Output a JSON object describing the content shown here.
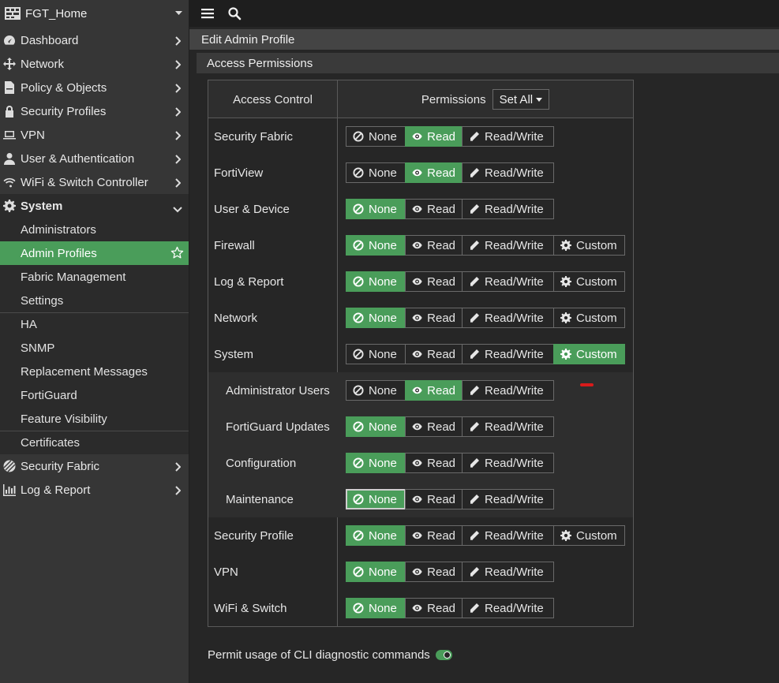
{
  "device": {
    "name": "FGT_Home"
  },
  "nav": {
    "dashboard": "Dashboard",
    "network": "Network",
    "policy": "Policy & Objects",
    "security_profiles": "Security Profiles",
    "vpn": "VPN",
    "user_auth": "User & Authentication",
    "wifi": "WiFi & Switch Controller",
    "system": "System",
    "system_items": {
      "administrators": "Administrators",
      "admin_profiles": "Admin Profiles",
      "fabric_management": "Fabric Management",
      "settings": "Settings",
      "ha": "HA",
      "snmp": "SNMP",
      "replacement_messages": "Replacement Messages",
      "fortiguard": "FortiGuard",
      "feature_visibility": "Feature Visibility",
      "certificates": "Certificates"
    },
    "security_fabric": "Security Fabric",
    "log_report": "Log & Report"
  },
  "page": {
    "title": "Edit Admin Profile",
    "section": "Access Permissions"
  },
  "table": {
    "col_access": "Access Control",
    "col_permissions": "Permissions",
    "set_all": "Set All",
    "opt_none": "None",
    "opt_read": "Read",
    "opt_rw": "Read/Write",
    "opt_custom": "Custom",
    "rows": [
      {
        "label": "Security Fabric",
        "selected": "Read",
        "custom": false
      },
      {
        "label": "FortiView",
        "selected": "Read",
        "custom": false
      },
      {
        "label": "User & Device",
        "selected": "None",
        "custom": false
      },
      {
        "label": "Firewall",
        "selected": "None",
        "custom": true
      },
      {
        "label": "Log & Report",
        "selected": "None",
        "custom": true
      },
      {
        "label": "Network",
        "selected": "None",
        "custom": true
      },
      {
        "label": "System",
        "selected": "Custom",
        "custom": true
      },
      {
        "label": "Administrator Users",
        "selected": "Read",
        "custom": false
      },
      {
        "label": "FortiGuard Updates",
        "selected": "None",
        "custom": false
      },
      {
        "label": "Configuration",
        "selected": "None",
        "custom": false
      },
      {
        "label": "Maintenance",
        "selected": "None",
        "custom": false
      },
      {
        "label": "Security Profile",
        "selected": "None",
        "custom": true
      },
      {
        "label": "VPN",
        "selected": "None",
        "custom": false
      },
      {
        "label": "WiFi & Switch",
        "selected": "None",
        "custom": false
      }
    ]
  },
  "cli": {
    "label": "Permit usage of CLI diagnostic commands",
    "enabled": true
  },
  "colors": {
    "accent": "#4a9d5a",
    "sidebar_bg": "#363636",
    "topbar_bg": "#1e1e1e",
    "marker": "#d81b1b"
  }
}
